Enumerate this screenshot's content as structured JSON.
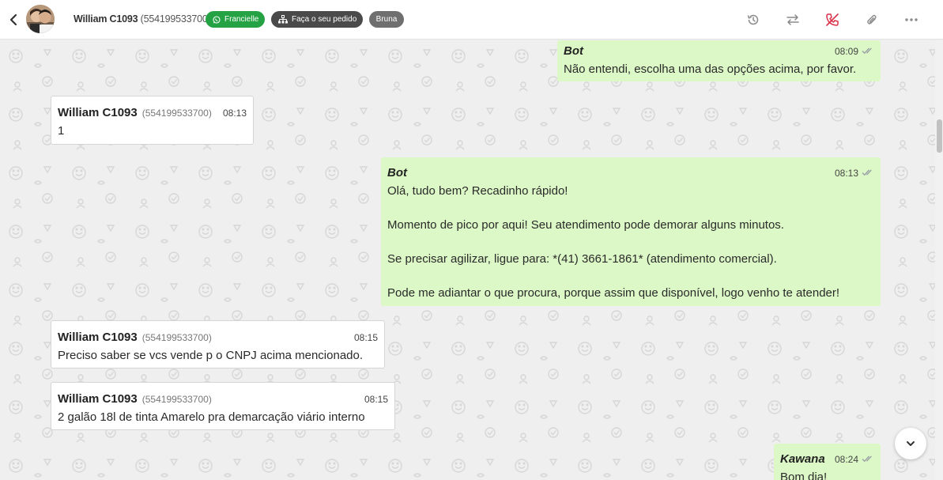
{
  "header": {
    "contact_name": "William C1093",
    "contact_phone": "(554199533700)",
    "tags": [
      {
        "label": "Francielle",
        "icon": "whatsapp-icon",
        "color": "#25a244"
      },
      {
        "label": "Faça o seu pedido",
        "icon": "sitemap-icon",
        "color": "#4a4a4a"
      },
      {
        "label": "Bruna",
        "color": "#6f6f6f"
      }
    ],
    "actions": [
      "history-icon",
      "transfer-icon",
      "end-call-icon",
      "attach-icon",
      "more-icon"
    ]
  },
  "messages": [
    {
      "direction": "out",
      "author": "Bot",
      "time": "08:09",
      "body": "Não entendi, escolha uma das opções acima, por favor."
    },
    {
      "direction": "in",
      "author": "William C1093",
      "phone": "(554199533700)",
      "time": "08:13",
      "body": "1"
    },
    {
      "direction": "out",
      "author": "Bot",
      "time": "08:13",
      "body": "Olá, tudo bem? Recadinho rápido!\n\nMomento de pico por aqui! Seu atendimento pode demorar alguns minutos.\n\nSe precisar agilizar, ligue para: *(41) 3661-1861* (atendimento comercial).\n\nPode me adiantar o que procura, porque assim que disponível, logo venho te atender!"
    },
    {
      "direction": "in",
      "author": "William C1093",
      "phone": "(554199533700)",
      "time": "08:15",
      "body": "Preciso saber se vcs vende p o CNPJ acima mencionado."
    },
    {
      "direction": "in",
      "author": "William C1093",
      "phone": "(554199533700)",
      "time": "08:15",
      "body": "2 galão 18l de tinta Amarelo pra demarcação viário interno"
    },
    {
      "direction": "out",
      "author": "Kawana",
      "time": "08:24",
      "body": "Bom dia!"
    }
  ],
  "colors": {
    "outgoing": "#dcf8c6",
    "incoming": "#ffffff",
    "accent_red": "#d9324a",
    "ticks": "#9aa0a6"
  }
}
